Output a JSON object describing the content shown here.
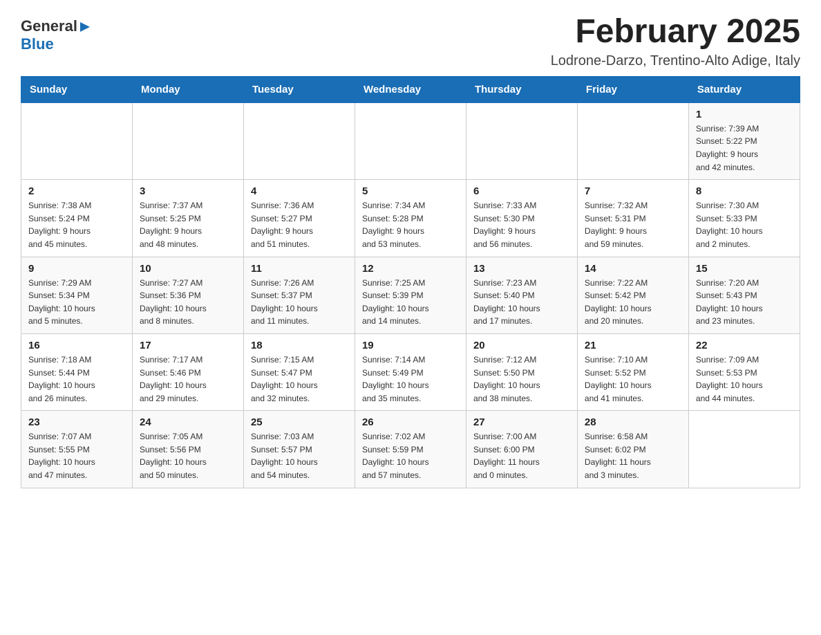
{
  "header": {
    "logo": {
      "general": "General",
      "arrow": "▶",
      "blue": "Blue"
    },
    "title": "February 2025",
    "subtitle": "Lodrone-Darzo, Trentino-Alto Adige, Italy"
  },
  "calendar": {
    "weekdays": [
      "Sunday",
      "Monday",
      "Tuesday",
      "Wednesday",
      "Thursday",
      "Friday",
      "Saturday"
    ],
    "weeks": [
      [
        {
          "day": "",
          "info": ""
        },
        {
          "day": "",
          "info": ""
        },
        {
          "day": "",
          "info": ""
        },
        {
          "day": "",
          "info": ""
        },
        {
          "day": "",
          "info": ""
        },
        {
          "day": "",
          "info": ""
        },
        {
          "day": "1",
          "info": "Sunrise: 7:39 AM\nSunset: 5:22 PM\nDaylight: 9 hours\nand 42 minutes."
        }
      ],
      [
        {
          "day": "2",
          "info": "Sunrise: 7:38 AM\nSunset: 5:24 PM\nDaylight: 9 hours\nand 45 minutes."
        },
        {
          "day": "3",
          "info": "Sunrise: 7:37 AM\nSunset: 5:25 PM\nDaylight: 9 hours\nand 48 minutes."
        },
        {
          "day": "4",
          "info": "Sunrise: 7:36 AM\nSunset: 5:27 PM\nDaylight: 9 hours\nand 51 minutes."
        },
        {
          "day": "5",
          "info": "Sunrise: 7:34 AM\nSunset: 5:28 PM\nDaylight: 9 hours\nand 53 minutes."
        },
        {
          "day": "6",
          "info": "Sunrise: 7:33 AM\nSunset: 5:30 PM\nDaylight: 9 hours\nand 56 minutes."
        },
        {
          "day": "7",
          "info": "Sunrise: 7:32 AM\nSunset: 5:31 PM\nDaylight: 9 hours\nand 59 minutes."
        },
        {
          "day": "8",
          "info": "Sunrise: 7:30 AM\nSunset: 5:33 PM\nDaylight: 10 hours\nand 2 minutes."
        }
      ],
      [
        {
          "day": "9",
          "info": "Sunrise: 7:29 AM\nSunset: 5:34 PM\nDaylight: 10 hours\nand 5 minutes."
        },
        {
          "day": "10",
          "info": "Sunrise: 7:27 AM\nSunset: 5:36 PM\nDaylight: 10 hours\nand 8 minutes."
        },
        {
          "day": "11",
          "info": "Sunrise: 7:26 AM\nSunset: 5:37 PM\nDaylight: 10 hours\nand 11 minutes."
        },
        {
          "day": "12",
          "info": "Sunrise: 7:25 AM\nSunset: 5:39 PM\nDaylight: 10 hours\nand 14 minutes."
        },
        {
          "day": "13",
          "info": "Sunrise: 7:23 AM\nSunset: 5:40 PM\nDaylight: 10 hours\nand 17 minutes."
        },
        {
          "day": "14",
          "info": "Sunrise: 7:22 AM\nSunset: 5:42 PM\nDaylight: 10 hours\nand 20 minutes."
        },
        {
          "day": "15",
          "info": "Sunrise: 7:20 AM\nSunset: 5:43 PM\nDaylight: 10 hours\nand 23 minutes."
        }
      ],
      [
        {
          "day": "16",
          "info": "Sunrise: 7:18 AM\nSunset: 5:44 PM\nDaylight: 10 hours\nand 26 minutes."
        },
        {
          "day": "17",
          "info": "Sunrise: 7:17 AM\nSunset: 5:46 PM\nDaylight: 10 hours\nand 29 minutes."
        },
        {
          "day": "18",
          "info": "Sunrise: 7:15 AM\nSunset: 5:47 PM\nDaylight: 10 hours\nand 32 minutes."
        },
        {
          "day": "19",
          "info": "Sunrise: 7:14 AM\nSunset: 5:49 PM\nDaylight: 10 hours\nand 35 minutes."
        },
        {
          "day": "20",
          "info": "Sunrise: 7:12 AM\nSunset: 5:50 PM\nDaylight: 10 hours\nand 38 minutes."
        },
        {
          "day": "21",
          "info": "Sunrise: 7:10 AM\nSunset: 5:52 PM\nDaylight: 10 hours\nand 41 minutes."
        },
        {
          "day": "22",
          "info": "Sunrise: 7:09 AM\nSunset: 5:53 PM\nDaylight: 10 hours\nand 44 minutes."
        }
      ],
      [
        {
          "day": "23",
          "info": "Sunrise: 7:07 AM\nSunset: 5:55 PM\nDaylight: 10 hours\nand 47 minutes."
        },
        {
          "day": "24",
          "info": "Sunrise: 7:05 AM\nSunset: 5:56 PM\nDaylight: 10 hours\nand 50 minutes."
        },
        {
          "day": "25",
          "info": "Sunrise: 7:03 AM\nSunset: 5:57 PM\nDaylight: 10 hours\nand 54 minutes."
        },
        {
          "day": "26",
          "info": "Sunrise: 7:02 AM\nSunset: 5:59 PM\nDaylight: 10 hours\nand 57 minutes."
        },
        {
          "day": "27",
          "info": "Sunrise: 7:00 AM\nSunset: 6:00 PM\nDaylight: 11 hours\nand 0 minutes."
        },
        {
          "day": "28",
          "info": "Sunrise: 6:58 AM\nSunset: 6:02 PM\nDaylight: 11 hours\nand 3 minutes."
        },
        {
          "day": "",
          "info": ""
        }
      ]
    ]
  }
}
